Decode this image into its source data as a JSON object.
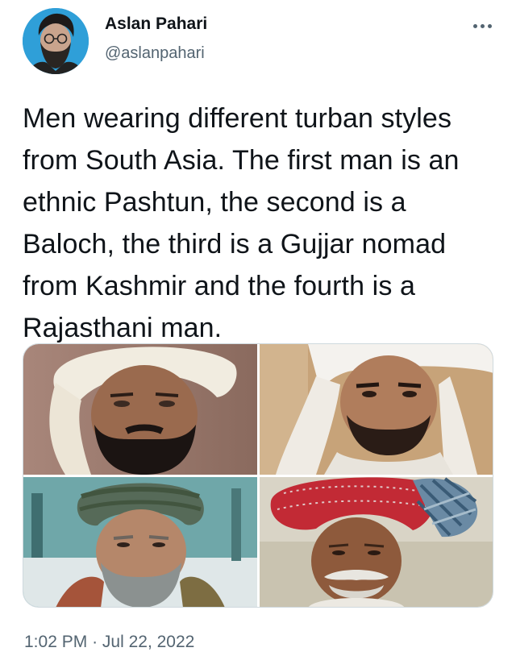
{
  "author": {
    "name": "Aslan Pahari",
    "handle": "@aslanpahari",
    "avatar_icon": "bearded-man-avatar",
    "avatar_bg": "#2f9fd8"
  },
  "tweet": {
    "text": "Men wearing different turban styles from South Asia. The first man is an ethnic Pashtun, the second is a Baloch, the third is a Gujjar nomad from Kashmir and the fourth is a Rajasthani man.",
    "time": "1:02 PM",
    "separator": "·",
    "date": "Jul 22, 2022"
  },
  "media": {
    "photos": [
      {
        "subject": "pashtun-man-white-turban",
        "turban_color": "#f1ece0"
      },
      {
        "subject": "baloch-man-white-turban",
        "turban_color": "#f4f2ee"
      },
      {
        "subject": "gujjar-man-green-turban",
        "turban_color": "#566a58"
      },
      {
        "subject": "rajasthani-man-red-turban",
        "turban_color": "#c22a35"
      }
    ]
  },
  "colors": {
    "text_primary": "#0f1419",
    "text_secondary": "#536471",
    "border": "#cfd9de"
  },
  "icons": {
    "more": "more-horizontal-icon"
  }
}
